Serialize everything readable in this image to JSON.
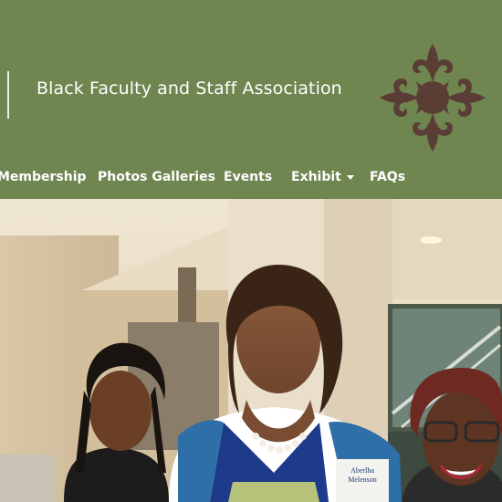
{
  "header": {
    "site_title": "Black Faculty and Staff Association",
    "logo_icon": "adinkra-symbol-icon",
    "background_color": "#6f8651",
    "logo_color": "#5a3e35"
  },
  "nav": {
    "items": [
      {
        "label": "Membership"
      },
      {
        "label": "Photos Galleries"
      },
      {
        "label": "Events"
      },
      {
        "label": "Exhibit",
        "has_dropdown": true
      },
      {
        "label": "FAQs"
      }
    ]
  },
  "hero": {
    "badge_lines": [
      "Aberlha",
      "Melenson"
    ]
  }
}
